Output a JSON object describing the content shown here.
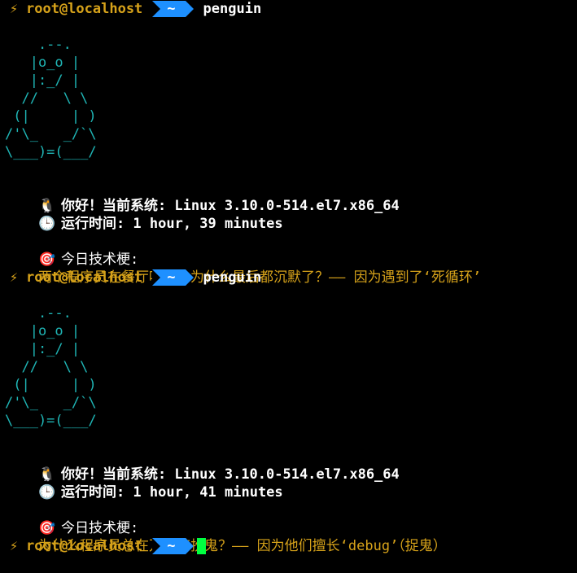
{
  "prompt": {
    "bolt": "⚡",
    "userhost": "root@localhost",
    "dir": "~",
    "command": "penguin"
  },
  "blocks": [
    {
      "penguin_art": [
        "    .--.",
        "   |o_o |",
        "   |:_/ |",
        "  //   \\ \\",
        " (|     | )",
        "/'\\_   _/`\\",
        "\\___)=(___/"
      ],
      "greeting_icon": "penguin-icon",
      "greeting": "你好！当前系统: Linux 3.10.0-514.el7.x86_64",
      "uptime_icon": "clock-icon",
      "uptime": "运行时间: 1 hour, 39 minutes",
      "joke_icon": "target-icon",
      "joke_title": "今日技术梗:",
      "joke": "两个程序员在餐厅吵架，为什么最后都沉默了？—— 因为遇到了‘死循环’"
    },
    {
      "penguin_art": [
        "    .--.",
        "   |o_o |",
        "   |:_/ |",
        "  //   \\ \\",
        " (|     | )",
        "/'\\_   _/`\\",
        "\\___)=(___/"
      ],
      "greeting_icon": "penguin-icon",
      "greeting": "你好！当前系统: Linux 3.10.0-514.el7.x86_64",
      "uptime_icon": "clock-icon",
      "uptime": "运行时间: 1 hour, 41 minutes",
      "joke_icon": "target-icon",
      "joke_title": "今日技术梗:",
      "joke": "为什么程序员总在万圣节扮鬼？—— 因为他们擅长‘debug’（捉鬼）"
    }
  ],
  "colors": {
    "background": "#000000",
    "prompt_accent": "#d6a21a",
    "dir_segment": "#1e90ff",
    "art": "#1fb5b5",
    "cursor": "#00ff40"
  }
}
